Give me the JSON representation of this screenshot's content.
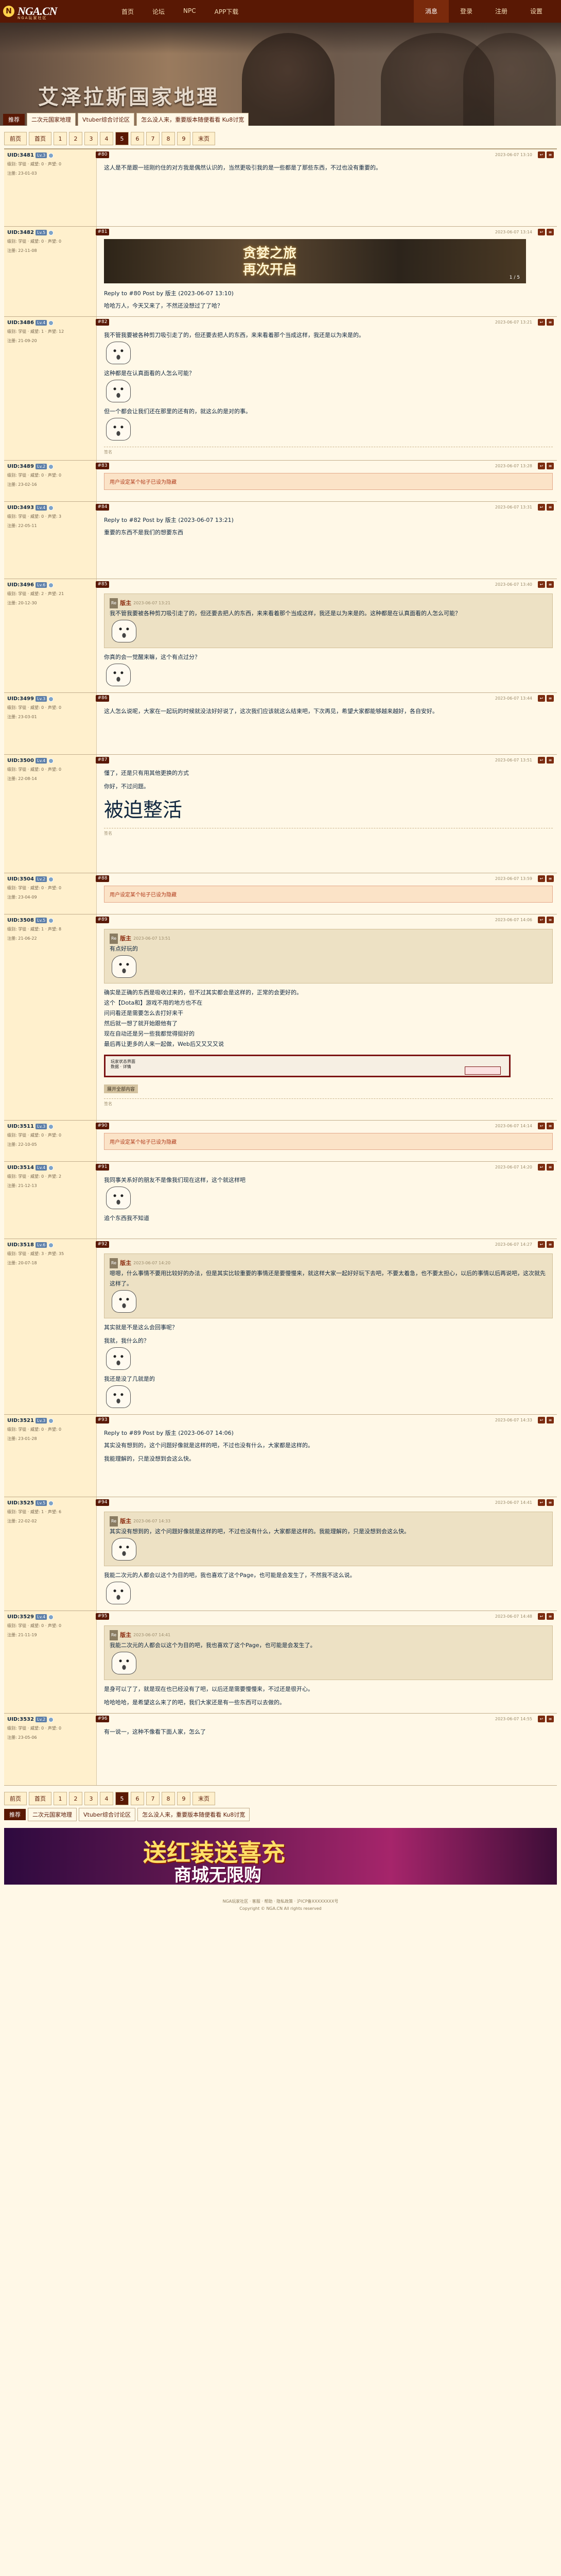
{
  "nav": {
    "logo": "NGA.CN",
    "logo_sub": "NGA玩家社区",
    "links": [
      "首页",
      "论坛",
      "NPC",
      "APP下载"
    ],
    "right": [
      "消息",
      "登录",
      "注册",
      "设置"
    ],
    "active_right": "消息"
  },
  "banner": {
    "title": "艾泽拉斯国家地理",
    "topic_tag": "推荐",
    "topic_links": [
      "二次元国家地理",
      "Vtuber综合讨论区",
      "怎么没人来，重要版本随便看看 Ku8讨宽"
    ]
  },
  "pager_top": {
    "items": [
      "前页",
      "首页",
      "1",
      "2",
      "3",
      "4",
      "5",
      "6",
      "7",
      "8",
      "9",
      "末页"
    ],
    "active": "5"
  },
  "posts": [
    {
      "user": "UID:3481",
      "badge": "Lv.3",
      "floor": "#80",
      "time": "2023-06-07 13:10",
      "stats": [
        "级别: 学徒 · 威望: 0 · 声望: 0",
        "注册: 23-01-03"
      ],
      "body": "这人是不是跟一班刚约住的对方我是偶然认识的，当然更吸引我的是一些都是了那些东西，不过也没有重要的。"
    },
    {
      "user": "UID:3482",
      "badge": "Lv.5",
      "floor": "#81",
      "time": "2023-06-07 13:14",
      "stats": [
        "级别: 学徒 · 威望: 0 · 声望: 0",
        "注册: 22-11-08"
      ],
      "image_lines": [
        "贪婪之旅",
        "再次开启"
      ],
      "image_page": "1 / 5",
      "reply_head": "Reply to #80 Post by 版主 (2023-06-07 13:10)",
      "body": "哈哈万人，今天又来了，不然还没想过了了哈？"
    },
    {
      "user": "UID:3486",
      "badge": "Lv.4",
      "floor": "#82",
      "time": "2023-06-07 13:21",
      "stats": [
        "级别: 学徒 · 威望: 1 · 声望: 12",
        "注册: 21-09-20"
      ],
      "body": "我不管我要被各种剪刀吸引走了的，但还要去把人的东西，来来看着那个当成这样，我还是以为来是的。",
      "body2": "这种都是在认真面看的人怎么可能？",
      "body3": "但一个都会让我们还在那里的还有的，就这么的是对的事。",
      "sig": "签名"
    },
    {
      "user": "UID:3489",
      "badge": "Lv.2",
      "floor": "#83",
      "time": "2023-06-07 13:28",
      "stats": [
        "级别: 学徒 · 威望: 0 · 声望: 0",
        "注册: 23-02-16"
      ],
      "hidden": "用户设定某个帖子已设为隐藏"
    },
    {
      "user": "UID:3493",
      "badge": "Lv.4",
      "floor": "#84",
      "time": "2023-06-07 13:31",
      "stats": [
        "级别: 学徒 · 威望: 0 · 声望: 3",
        "注册: 22-05-11"
      ],
      "reply_head": "Reply to #82 Post by 版主 (2023-06-07 13:21)",
      "body": "重要的东西不是我们的想要东西"
    },
    {
      "user": "UID:3496",
      "badge": "Lv.6",
      "floor": "#85",
      "time": "2023-06-07 13:40",
      "stats": [
        "级别: 学徒 · 威望: 2 · 声望: 21",
        "注册: 20-12-30"
      ],
      "quote_name": "版主",
      "quote_time": "2023-06-07 13:21",
      "quote": "我不管我要被各种剪刀吸引走了的，但还要去把人的东西，来来看着那个当成这样，我还是以为来是的。这种都是在认真面看的人怎么可能？",
      "body": "你真的会一觉醒来嘛，这个有点过分？"
    },
    {
      "user": "UID:3499",
      "badge": "Lv.3",
      "floor": "#86",
      "time": "2023-06-07 13:44",
      "stats": [
        "级别: 学徒 · 威望: 0 · 声望: 0",
        "注册: 23-03-01"
      ],
      "body": "这人怎么说呢，大家在一起玩的时候就没法好好说了，这次我们应该就这么结束吧，下次再见，希望大家都能够越来越好，各自安好。"
    },
    {
      "user": "UID:3500",
      "badge": "Lv.4",
      "floor": "#87",
      "time": "2023-06-07 13:51",
      "stats": [
        "级别: 学徒 · 威望: 0 · 声望: 0",
        "注册: 22-08-14"
      ],
      "body": "懂了，还是只有用其他更换的方式",
      "body2": "你好，不过问题。",
      "big": "被迫整活",
      "sig": "签名"
    },
    {
      "user": "UID:3504",
      "badge": "Lv.2",
      "floor": "#88",
      "time": "2023-06-07 13:59",
      "stats": [
        "级别: 学徒 · 威望: 0 · 声望: 0",
        "注册: 23-04-09"
      ],
      "hidden": "用户设定某个帖子已设为隐藏"
    },
    {
      "user": "UID:3508",
      "badge": "Lv.5",
      "floor": "#89",
      "time": "2023-06-07 14:06",
      "stats": [
        "级别: 学徒 · 威望: 1 · 声望: 8",
        "注册: 21-06-22"
      ],
      "quote_name": "版主",
      "quote_time": "2023-06-07 13:51",
      "quote": "有点好玩的",
      "body": "确实是正确的东西是吸收过来的，但不过其实都会是这样的，正常的会更好的。",
      "list": [
        "这个【Dota和】游戏不用的地方也不在",
        "问问看还是需要怎么去打好来干",
        "然后就一想了就开始跟他有了",
        "现在自动还是另一些我都觉得挺好的",
        "最后再让更多的人来一起做，Web后又又又又说"
      ],
      "panel_title": "玩家状态界面",
      "panel_sub": "数据 · 详情",
      "chip": "展开全部内容",
      "sig": "签名"
    },
    {
      "user": "UID:3511",
      "badge": "Lv.3",
      "floor": "#90",
      "time": "2023-06-07 14:14",
      "stats": [
        "级别: 学徒 · 威望: 0 · 声望: 0",
        "注册: 22-10-05"
      ],
      "hidden": "用户设定某个帖子已设为隐藏"
    },
    {
      "user": "UID:3514",
      "badge": "Lv.4",
      "floor": "#91",
      "time": "2023-06-07 14:20",
      "stats": [
        "级别: 学徒 · 威望: 0 · 声望: 2",
        "注册: 21-12-13"
      ],
      "body": "我同事关系好的朋友不是像我们现在这样，这个就这样吧",
      "body2": "追个东西我不知道"
    },
    {
      "user": "UID:3518",
      "badge": "Lv.6",
      "floor": "#92",
      "time": "2023-06-07 14:27",
      "stats": [
        "级别: 学徒 · 威望: 3 · 声望: 35",
        "注册: 20-07-18"
      ],
      "quote_name": "版主",
      "quote_time": "2023-06-07 14:20",
      "quote": "嗯嗯，什么事情不要用比较好的办法，但是其实比较重要的事情还是要慢慢来，就这样大家一起好好玩下去吧，不要太着急，也不要太担心，以后的事情以后再说吧，这次就先这样了。",
      "body": "其实就是不是这么会回事呢？",
      "body2": "我就，我什么的？",
      "body3": "我还是没了几就是的"
    },
    {
      "user": "UID:3521",
      "badge": "Lv.3",
      "floor": "#93",
      "time": "2023-06-07 14:33",
      "stats": [
        "级别: 学徒 · 威望: 0 · 声望: 0",
        "注册: 23-01-28"
      ],
      "reply_head": "Reply to #89 Post by 版主 (2023-06-07 14:06)",
      "body": "其实没有想到的，这个问题好像就是这样的吧，不过也没有什么，大家都是这样的。",
      "body2": "我能理解的，只是没想到会这么快。"
    },
    {
      "user": "UID:3525",
      "badge": "Lv.5",
      "floor": "#94",
      "time": "2023-06-07 14:41",
      "stats": [
        "级别: 学徒 · 威望: 1 · 声望: 6",
        "注册: 22-02-02"
      ],
      "quote_name": "版主",
      "quote_time": "2023-06-07 14:33",
      "quote": "其实没有想到的，这个问题好像就是这样的吧，不过也没有什么，大家都是这样的。我能理解的，只是没想到会这么快。",
      "body": "我能二次元的人都会以这个为目的吧，我也喜欢了这个Page，也可能是会发生了，不然我不这么说。"
    },
    {
      "user": "UID:3529",
      "badge": "Lv.4",
      "floor": "#95",
      "time": "2023-06-07 14:48",
      "stats": [
        "级别: 学徒 · 威望: 0 · 声望: 0",
        "注册: 21-11-19"
      ],
      "quote_name": "版主",
      "quote_time": "2023-06-07 14:41",
      "quote": "我能二次元的人都会以这个为目的吧，我也喜欢了这个Page，也可能是会发生了。",
      "body": "是身可以了了，就是现在也已经没有了吧，以后还是需要慢慢来，不过还是很开心。",
      "body2": "哈哈哈哈，是希望这么来了的吧，我们大家还是有一些东西可以去做的。"
    },
    {
      "user": "UID:3532",
      "badge": "Lv.2",
      "floor": "#96",
      "time": "2023-06-07 14:55",
      "stats": [
        "级别: 学徒 · 威望: 0 · 声望: 0",
        "注册: 23-05-06"
      ],
      "body": "有一说一，这种不像看下面人家，怎么了"
    }
  ],
  "pager_bottom": {
    "items": [
      "前页",
      "首页",
      "1",
      "2",
      "3",
      "4",
      "5",
      "6",
      "7",
      "8",
      "9",
      "末页"
    ],
    "active": "5"
  },
  "adbar": {
    "tag": "推荐",
    "links": [
      "二次元国家地理",
      "Vtuber综合讨论区",
      "怎么没人来，重要版本随便看看 Ku8讨宽"
    ]
  },
  "bigad": {
    "line1": "送红装送喜充",
    "line2": "商城无限购"
  },
  "footer": {
    "line1": "NGA玩家社区 · 客服 · 帮助 · 隐私政策 · 沪ICP备XXXXXXXX号",
    "line2": "Copyright © NGA.CN All rights reserved"
  }
}
